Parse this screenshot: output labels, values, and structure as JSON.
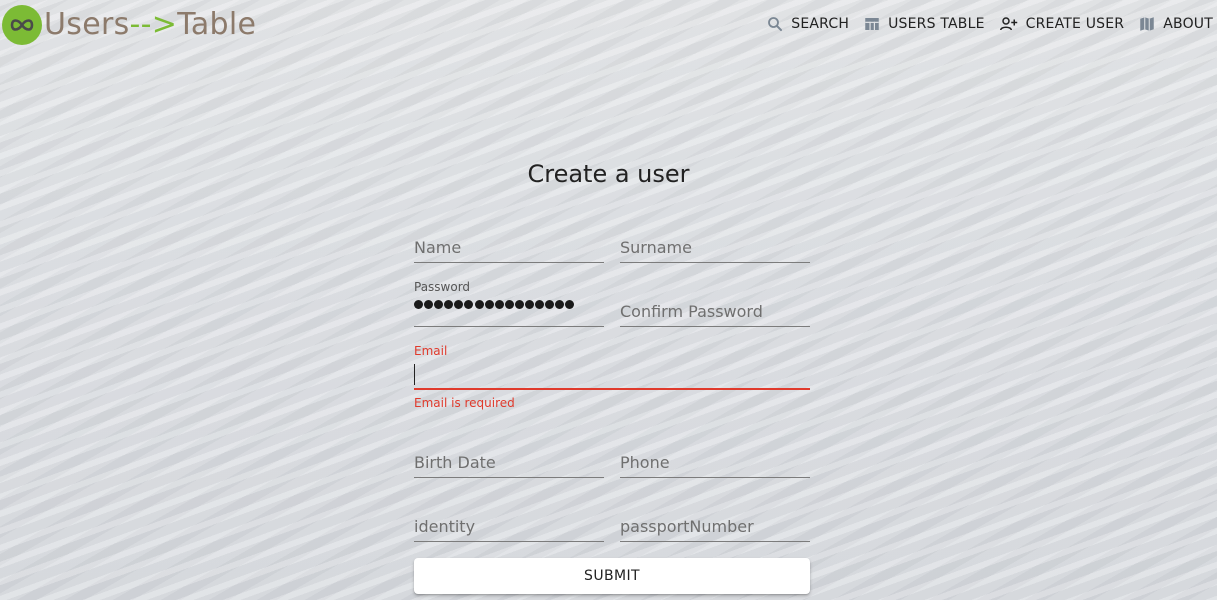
{
  "brand": {
    "part1": "Users",
    "part2": "-->",
    "part3": "Table",
    "logo_icon": "infinity-icon",
    "green": "#7cbb35",
    "brown": "#8c7a6b"
  },
  "nav": {
    "items": [
      {
        "label": "SEARCH",
        "icon": "search-icon"
      },
      {
        "label": "USERS TABLE",
        "icon": "table-icon"
      },
      {
        "label": "CREATE USER",
        "icon": "person-add-icon"
      },
      {
        "label": "ABOUT",
        "icon": "map-icon"
      }
    ],
    "icon_color": "#7b8794"
  },
  "form": {
    "title": "Create a user",
    "name_placeholder": "Name",
    "surname_placeholder": "Surname",
    "password_label": "Password",
    "password_masked_length": 16,
    "confirm_password_placeholder": "Confirm Password",
    "email_label": "Email",
    "email_value": "",
    "email_error": "Email is required",
    "birth_date_placeholder": "Birth Date",
    "phone_placeholder": "Phone",
    "identity_placeholder": "identity",
    "passport_placeholder": "passportNumber",
    "submit_label": "SUBMIT",
    "error_color": "#e03a2c"
  }
}
